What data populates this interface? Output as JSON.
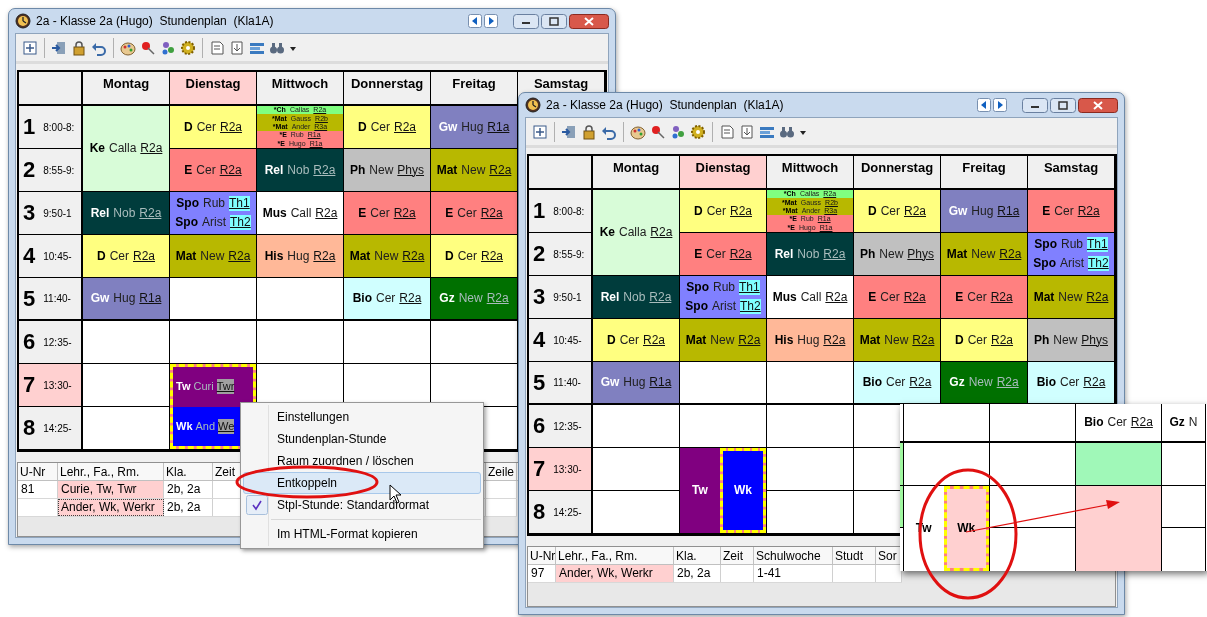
{
  "windows": [
    {
      "title": "2a - Klasse 2a (Hugo)  Stundenplan  (Kla1A)",
      "days": [
        {
          "label": "Montag",
          "highlighted": false,
          "slots": [
            {
              "kind": "lesson",
              "blocks": [
                {
                  "kind": "single",
                  "color": "#d8fcd8",
                  "selected": false,
                  "lines": [
                    {
                      "subject": "Ke",
                      "teacher": "Calla",
                      "room": "R2a",
                      "room_highlighted": false
                    }
                  ]
                }
              ]
            },
            {
              "kind": "continued"
            },
            {
              "kind": "lesson",
              "blocks": [
                {
                  "kind": "single",
                  "color": "#003c3c",
                  "selected": false,
                  "lines": [
                    {
                      "subject": "Rel",
                      "teacher": "Nob",
                      "room": "R2a",
                      "room_highlighted": false
                    }
                  ]
                }
              ]
            },
            {
              "kind": "lesson",
              "blocks": [
                {
                  "kind": "single",
                  "color": "#ffff80",
                  "selected": false,
                  "lines": [
                    {
                      "subject": "D",
                      "teacher": "Cer",
                      "room": "R2a",
                      "room_highlighted": false
                    }
                  ]
                }
              ]
            },
            {
              "kind": "lesson",
              "blocks": [
                {
                  "kind": "single",
                  "color": "#8080c0",
                  "selected": false,
                  "lines": [
                    {
                      "subject": "Gw",
                      "teacher": "Hug",
                      "room": "R1a",
                      "room_highlighted": false
                    }
                  ]
                }
              ]
            },
            {
              "kind": "empty"
            },
            {
              "kind": "empty"
            },
            {
              "kind": "empty"
            }
          ]
        },
        {
          "label": "Dienstag",
          "highlighted": true,
          "slots": [
            {
              "kind": "lesson",
              "blocks": [
                {
                  "kind": "single",
                  "color": "#ffff80",
                  "selected": false,
                  "lines": [
                    {
                      "subject": "D",
                      "teacher": "Cer",
                      "room": "R2a",
                      "room_highlighted": false
                    }
                  ]
                }
              ]
            },
            {
              "kind": "lesson",
              "blocks": [
                {
                  "kind": "single",
                  "color": "#ff8080",
                  "selected": false,
                  "lines": [
                    {
                      "subject": "E",
                      "teacher": "Cer",
                      "room": "R2a",
                      "room_highlighted": false
                    }
                  ]
                }
              ]
            },
            {
              "kind": "lesson",
              "blocks": [
                {
                  "kind": "single",
                  "color": "#8080ff",
                  "selected": false,
                  "lines": [
                    {
                      "subject": "Spo",
                      "teacher": "Rub",
                      "room": "Th1",
                      "room_highlighted": true
                    },
                    {
                      "subject": "Spo",
                      "teacher": "Arist",
                      "room": "Th2",
                      "room_highlighted": true
                    }
                  ]
                }
              ]
            },
            {
              "kind": "lesson",
              "blocks": [
                {
                  "kind": "single",
                  "color": "#b8b800",
                  "selected": false,
                  "lines": [
                    {
                      "subject": "Mat",
                      "teacher": "New",
                      "room": "R2a",
                      "room_highlighted": false
                    }
                  ]
                }
              ]
            },
            {
              "kind": "empty"
            },
            {
              "kind": "empty"
            },
            {
              "kind": "lesson",
              "blocks": [
                {
                  "kind": "split",
                  "color": "#ff8080",
                  "selected": true,
                  "lines": [
                    {
                      "subject": "Tw",
                      "teacher": "Curi",
                      "room": "Twr",
                      "room_highlighted": true,
                      "color": "#800080"
                    },
                    {
                      "subject": "Wk",
                      "teacher": "And",
                      "room": "We",
                      "room_highlighted": true,
                      "color": "#0000ff"
                    }
                  ]
                }
              ]
            },
            {
              "kind": "continued"
            }
          ]
        },
        {
          "label": "Mittwoch",
          "highlighted": false,
          "slots": [
            {
              "kind": "lesson",
              "blocks": [
                {
                  "kind": "compact",
                  "selected": false,
                  "lines": [
                    {
                      "subject": "*Ch",
                      "teacher": "Callas",
                      "room": "R2a",
                      "room_highlighted": false,
                      "color": "#80ff80"
                    },
                    {
                      "subject": "*Mat",
                      "teacher": "Gauss",
                      "room": "R2b",
                      "room_highlighted": false,
                      "color": "#b8b800"
                    },
                    {
                      "subject": "*Mat",
                      "teacher": "Ander",
                      "room": "R3a",
                      "room_highlighted": false,
                      "color": "#b8b800"
                    },
                    {
                      "subject": "*E",
                      "teacher": "Rub",
                      "room": "R1a",
                      "room_highlighted": false,
                      "color": "#ff8080"
                    },
                    {
                      "subject": "*E",
                      "teacher": "Hugo",
                      "room": "R1a",
                      "room_highlighted": false,
                      "color": "#ff8080"
                    }
                  ]
                }
              ]
            },
            {
              "kind": "lesson",
              "blocks": [
                {
                  "kind": "single",
                  "color": "#003c3c",
                  "selected": false,
                  "lines": [
                    {
                      "subject": "Rel",
                      "teacher": "Nob",
                      "room": "R2a",
                      "room_highlighted": false
                    }
                  ]
                }
              ]
            },
            {
              "kind": "lesson",
              "blocks": [
                {
                  "kind": "single",
                  "color": "#ffffff",
                  "selected": false,
                  "lines": [
                    {
                      "subject": "Mus",
                      "teacher": "Call",
                      "room": "R2a",
                      "room_highlighted": false
                    }
                  ]
                }
              ]
            },
            {
              "kind": "lesson",
              "blocks": [
                {
                  "kind": "single",
                  "color": "#ffb898",
                  "selected": false,
                  "lines": [
                    {
                      "subject": "His",
                      "teacher": "Hug",
                      "room": "R2a",
                      "room_highlighted": false
                    }
                  ]
                }
              ]
            },
            {
              "kind": "empty"
            },
            {
              "kind": "empty"
            },
            {
              "kind": "empty"
            },
            {
              "kind": "empty"
            }
          ]
        },
        {
          "label": "Donnerstag",
          "highlighted": false,
          "slots": [
            {
              "kind": "lesson",
              "blocks": [
                {
                  "kind": "single",
                  "color": "#ffff80",
                  "selected": false,
                  "lines": [
                    {
                      "subject": "D",
                      "teacher": "Cer",
                      "room": "R2a",
                      "room_highlighted": false
                    }
                  ]
                }
              ]
            },
            {
              "kind": "lesson",
              "blocks": [
                {
                  "kind": "single",
                  "color": "#c0c0c0",
                  "selected": false,
                  "lines": [
                    {
                      "subject": "Ph",
                      "teacher": "New",
                      "room": "Phys",
                      "room_highlighted": false
                    }
                  ]
                }
              ]
            },
            {
              "kind": "lesson",
              "blocks": [
                {
                  "kind": "single",
                  "color": "#ff8080",
                  "selected": false,
                  "lines": [
                    {
                      "subject": "E",
                      "teacher": "Cer",
                      "room": "R2a",
                      "room_highlighted": false
                    }
                  ]
                }
              ]
            },
            {
              "kind": "lesson",
              "blocks": [
                {
                  "kind": "single",
                  "color": "#b8b800",
                  "selected": false,
                  "lines": [
                    {
                      "subject": "Mat",
                      "teacher": "New",
                      "room": "R2a",
                      "room_highlighted": false
                    }
                  ]
                }
              ]
            },
            {
              "kind": "lesson",
              "blocks": [
                {
                  "kind": "single",
                  "color": "#d0ffff",
                  "selected": false,
                  "lines": [
                    {
                      "subject": "Bio",
                      "teacher": "Cer",
                      "room": "R2a",
                      "room_highlighted": false
                    }
                  ]
                }
              ]
            },
            {
              "kind": "empty"
            },
            {
              "kind": "empty"
            },
            {
              "kind": "empty"
            }
          ]
        },
        {
          "label": "Freitag",
          "highlighted": false,
          "slots": [
            {
              "kind": "lesson",
              "blocks": [
                {
                  "kind": "single",
                  "color": "#8080c0",
                  "selected": false,
                  "lines": [
                    {
                      "subject": "Gw",
                      "teacher": "Hug",
                      "room": "R1a",
                      "room_highlighted": false
                    }
                  ]
                }
              ]
            },
            {
              "kind": "lesson",
              "blocks": [
                {
                  "kind": "single",
                  "color": "#b8b800",
                  "selected": false,
                  "lines": [
                    {
                      "subject": "Mat",
                      "teacher": "New",
                      "room": "R2a",
                      "room_highlighted": false
                    }
                  ]
                }
              ]
            },
            {
              "kind": "lesson",
              "blocks": [
                {
                  "kind": "single",
                  "color": "#ff8080",
                  "selected": false,
                  "lines": [
                    {
                      "subject": "E",
                      "teacher": "Cer",
                      "room": "R2a",
                      "room_highlighted": false
                    }
                  ]
                }
              ]
            },
            {
              "kind": "lesson",
              "blocks": [
                {
                  "kind": "single",
                  "color": "#ffff80",
                  "selected": false,
                  "lines": [
                    {
                      "subject": "D",
                      "teacher": "Cer",
                      "room": "R2a",
                      "room_highlighted": false
                    }
                  ]
                }
              ]
            },
            {
              "kind": "lesson",
              "blocks": [
                {
                  "kind": "single",
                  "color": "#007000",
                  "selected": false,
                  "lines": [
                    {
                      "subject": "Gz",
                      "teacher": "New",
                      "room": "R2a",
                      "room_highlighted": false
                    }
                  ]
                }
              ]
            },
            {
              "kind": "empty"
            },
            {
              "kind": "empty"
            },
            {
              "kind": "empty"
            }
          ]
        },
        {
          "label": "Samstag",
          "highlighted": false
        }
      ],
      "periods": [
        {
          "number": "1",
          "time": "8:00-8:",
          "highlighted": false
        },
        {
          "number": "2",
          "time": "8:55-9:",
          "highlighted": false
        },
        {
          "number": "3",
          "time": "9:50-1",
          "highlighted": false
        },
        {
          "number": "4",
          "time": "10:45-",
          "highlighted": false
        },
        {
          "number": "5",
          "time": "11:40-",
          "highlighted": false
        },
        {
          "number": "6",
          "time": "12:35-",
          "highlighted": false
        },
        {
          "number": "7",
          "time": "13:30-",
          "highlighted": true
        },
        {
          "number": "8",
          "time": "14:25-",
          "highlighted": false
        }
      ],
      "details": {
        "columns": [
          "U-Nr",
          "Lehr., Fa., Rm.",
          "Kla.",
          "Zeit",
          "Zeile"
        ],
        "rows": [
          {
            "selected": false,
            "cells": [
              "81",
              "Curie, Tw, Twr",
              "2b, 2a",
              null,
              null
            ]
          },
          {
            "selected": true,
            "cells": [
              null,
              "Ander, Wk, Werkr",
              "2b, 2a",
              null,
              null
            ]
          }
        ]
      }
    },
    {
      "title": "2a - Klasse 2a (Hugo)  Stundenplan  (Kla1A)",
      "days": [
        {
          "label": "Montag",
          "highlighted": false,
          "slots": [
            {
              "kind": "lesson",
              "blocks": [
                {
                  "kind": "single",
                  "color": "#d8fcd8",
                  "selected": false,
                  "lines": [
                    {
                      "subject": "Ke",
                      "teacher": "Calla",
                      "room": "R2a",
                      "room_highlighted": false
                    }
                  ]
                }
              ]
            },
            {
              "kind": "continued"
            },
            {
              "kind": "lesson",
              "blocks": [
                {
                  "kind": "single",
                  "color": "#003c3c",
                  "selected": false,
                  "lines": [
                    {
                      "subject": "Rel",
                      "teacher": "Nob",
                      "room": "R2a",
                      "room_highlighted": false
                    }
                  ]
                }
              ]
            },
            {
              "kind": "lesson",
              "blocks": [
                {
                  "kind": "single",
                  "color": "#ffff80",
                  "selected": false,
                  "lines": [
                    {
                      "subject": "D",
                      "teacher": "Cer",
                      "room": "R2a",
                      "room_highlighted": false
                    }
                  ]
                }
              ]
            },
            {
              "kind": "lesson",
              "blocks": [
                {
                  "kind": "single",
                  "color": "#8080c0",
                  "selected": false,
                  "lines": [
                    {
                      "subject": "Gw",
                      "teacher": "Hug",
                      "room": "R1a",
                      "room_highlighted": false
                    }
                  ]
                }
              ]
            },
            {
              "kind": "empty"
            },
            {
              "kind": "empty"
            },
            {
              "kind": "empty"
            }
          ]
        },
        {
          "label": "Dienstag",
          "highlighted": true,
          "slots": [
            {
              "kind": "lesson",
              "blocks": [
                {
                  "kind": "single",
                  "color": "#ffff80",
                  "selected": false,
                  "lines": [
                    {
                      "subject": "D",
                      "teacher": "Cer",
                      "room": "R2a",
                      "room_highlighted": false
                    }
                  ]
                }
              ]
            },
            {
              "kind": "lesson",
              "blocks": [
                {
                  "kind": "single",
                  "color": "#ff8080",
                  "selected": false,
                  "lines": [
                    {
                      "subject": "E",
                      "teacher": "Cer",
                      "room": "R2a",
                      "room_highlighted": false
                    }
                  ]
                }
              ]
            },
            {
              "kind": "lesson",
              "blocks": [
                {
                  "kind": "single",
                  "color": "#8080ff",
                  "selected": false,
                  "lines": [
                    {
                      "subject": "Spo",
                      "teacher": "Rub",
                      "room": "Th1",
                      "room_highlighted": true
                    },
                    {
                      "subject": "Spo",
                      "teacher": "Arist",
                      "room": "Th2",
                      "room_highlighted": true
                    }
                  ]
                }
              ]
            },
            {
              "kind": "lesson",
              "blocks": [
                {
                  "kind": "single",
                  "color": "#b8b800",
                  "selected": false,
                  "lines": [
                    {
                      "subject": "Mat",
                      "teacher": "New",
                      "room": "R2a",
                      "room_highlighted": false
                    }
                  ]
                }
              ]
            },
            {
              "kind": "empty"
            },
            {
              "kind": "empty"
            },
            {
              "kind": "lesson",
              "blocks": [
                {
                  "kind": "single",
                  "color": "#800080",
                  "selected": false,
                  "lines": [
                    {
                      "subject": "Tw"
                    }
                  ]
                },
                {
                  "kind": "single",
                  "color": "#0000ff",
                  "selected": true,
                  "lines": [
                    {
                      "subject": "Wk"
                    }
                  ]
                }
              ]
            },
            {
              "kind": "continued"
            }
          ]
        },
        {
          "label": "Mittwoch",
          "highlighted": false,
          "slots": [
            {
              "kind": "lesson",
              "blocks": [
                {
                  "kind": "compact",
                  "selected": false,
                  "lines": [
                    {
                      "subject": "*Ch",
                      "teacher": "Callas",
                      "room": "R2a",
                      "room_highlighted": false,
                      "color": "#80ff80"
                    },
                    {
                      "subject": "*Mat",
                      "teacher": "Gauss",
                      "room": "R2b",
                      "room_highlighted": false,
                      "color": "#b8b800"
                    },
                    {
                      "subject": "*Mat",
                      "teacher": "Ander",
                      "room": "R3a",
                      "room_highlighted": false,
                      "color": "#b8b800"
                    },
                    {
                      "subject": "*E",
                      "teacher": "Rub",
                      "room": "R1a",
                      "room_highlighted": false,
                      "color": "#ff8080"
                    },
                    {
                      "subject": "*E",
                      "teacher": "Hugo",
                      "room": "R1a",
                      "room_highlighted": false,
                      "color": "#ff8080"
                    }
                  ]
                }
              ]
            },
            {
              "kind": "lesson",
              "blocks": [
                {
                  "kind": "single",
                  "color": "#003c3c",
                  "selected": false,
                  "lines": [
                    {
                      "subject": "Rel",
                      "teacher": "Nob",
                      "room": "R2a",
                      "room_highlighted": false
                    }
                  ]
                }
              ]
            },
            {
              "kind": "lesson",
              "blocks": [
                {
                  "kind": "single",
                  "color": "#ffffff",
                  "selected": false,
                  "lines": [
                    {
                      "subject": "Mus",
                      "teacher": "Call",
                      "room": "R2a",
                      "room_highlighted": false
                    }
                  ]
                }
              ]
            },
            {
              "kind": "lesson",
              "blocks": [
                {
                  "kind": "single",
                  "color": "#ffb898",
                  "selected": false,
                  "lines": [
                    {
                      "subject": "His",
                      "teacher": "Hug",
                      "room": "R2a",
                      "room_highlighted": false
                    }
                  ]
                }
              ]
            },
            {
              "kind": "empty"
            },
            {
              "kind": "empty"
            },
            {
              "kind": "empty"
            },
            {
              "kind": "empty"
            }
          ]
        },
        {
          "label": "Donnerstag",
          "highlighted": false,
          "slots": [
            {
              "kind": "lesson",
              "blocks": [
                {
                  "kind": "single",
                  "color": "#ffff80",
                  "selected": false,
                  "lines": [
                    {
                      "subject": "D",
                      "teacher": "Cer",
                      "room": "R2a",
                      "room_highlighted": false
                    }
                  ]
                }
              ]
            },
            {
              "kind": "lesson",
              "blocks": [
                {
                  "kind": "single",
                  "color": "#c0c0c0",
                  "selected": false,
                  "lines": [
                    {
                      "subject": "Ph",
                      "teacher": "New",
                      "room": "Phys",
                      "room_highlighted": false
                    }
                  ]
                }
              ]
            },
            {
              "kind": "lesson",
              "blocks": [
                {
                  "kind": "single",
                  "color": "#ff8080",
                  "selected": false,
                  "lines": [
                    {
                      "subject": "E",
                      "teacher": "Cer",
                      "room": "R2a",
                      "room_highlighted": false
                    }
                  ]
                }
              ]
            },
            {
              "kind": "lesson",
              "blocks": [
                {
                  "kind": "single",
                  "color": "#b8b800",
                  "selected": false,
                  "lines": [
                    {
                      "subject": "Mat",
                      "teacher": "New",
                      "room": "R2a",
                      "room_highlighted": false
                    }
                  ]
                }
              ]
            },
            {
              "kind": "lesson",
              "blocks": [
                {
                  "kind": "single",
                  "color": "#d0ffff",
                  "selected": false,
                  "lines": [
                    {
                      "subject": "Bio",
                      "teacher": "Cer",
                      "room": "R2a",
                      "room_highlighted": false
                    }
                  ]
                }
              ]
            },
            {
              "kind": "empty"
            },
            {
              "kind": "empty"
            },
            {
              "kind": "empty"
            }
          ]
        },
        {
          "label": "Freitag",
          "highlighted": false,
          "slots": [
            {
              "kind": "lesson",
              "blocks": [
                {
                  "kind": "single",
                  "color": "#8080c0",
                  "selected": false,
                  "lines": [
                    {
                      "subject": "Gw",
                      "teacher": "Hug",
                      "room": "R1a",
                      "room_highlighted": false
                    }
                  ]
                }
              ]
            },
            {
              "kind": "lesson",
              "blocks": [
                {
                  "kind": "single",
                  "color": "#b8b800",
                  "selected": false,
                  "lines": [
                    {
                      "subject": "Mat",
                      "teacher": "New",
                      "room": "R2a",
                      "room_highlighted": false
                    }
                  ]
                }
              ]
            },
            {
              "kind": "lesson",
              "blocks": [
                {
                  "kind": "single",
                  "color": "#ff8080",
                  "selected": false,
                  "lines": [
                    {
                      "subject": "E",
                      "teacher": "Cer",
                      "room": "R2a",
                      "room_highlighted": false
                    }
                  ]
                }
              ]
            },
            {
              "kind": "lesson",
              "blocks": [
                {
                  "kind": "single",
                  "color": "#ffff80",
                  "selected": false,
                  "lines": [
                    {
                      "subject": "D",
                      "teacher": "Cer",
                      "room": "R2a",
                      "room_highlighted": false
                    }
                  ]
                }
              ]
            },
            {
              "kind": "lesson",
              "blocks": [
                {
                  "kind": "single",
                  "color": "#007000",
                  "selected": false,
                  "lines": [
                    {
                      "subject": "Gz",
                      "teacher": "New",
                      "room": "R2a",
                      "room_highlighted": false
                    }
                  ]
                }
              ]
            }
          ]
        },
        {
          "label": "Samstag",
          "highlighted": false,
          "slots": [
            {
              "kind": "lesson",
              "blocks": [
                {
                  "kind": "single",
                  "color": "#ff8080",
                  "selected": false,
                  "lines": [
                    {
                      "subject": "E",
                      "teacher": "Cer",
                      "room": "R2a",
                      "room_highlighted": false
                    }
                  ]
                }
              ]
            },
            {
              "kind": "lesson",
              "blocks": [
                {
                  "kind": "single",
                  "color": "#8080ff",
                  "selected": false,
                  "lines": [
                    {
                      "subject": "Spo",
                      "teacher": "Rub",
                      "room": "Th1",
                      "room_highlighted": true
                    },
                    {
                      "subject": "Spo",
                      "teacher": "Arist",
                      "room": "Th2",
                      "room_highlighted": true
                    }
                  ]
                }
              ]
            },
            {
              "kind": "lesson",
              "blocks": [
                {
                  "kind": "single",
                  "color": "#b8b800",
                  "selected": false,
                  "lines": [
                    {
                      "subject": "Mat",
                      "teacher": "New",
                      "room": "R2a",
                      "room_highlighted": false
                    }
                  ]
                }
              ]
            },
            {
              "kind": "lesson",
              "blocks": [
                {
                  "kind": "single",
                  "color": "#c0c0c0",
                  "selected": false,
                  "lines": [
                    {
                      "subject": "Ph",
                      "teacher": "New",
                      "room": "Phys",
                      "room_highlighted": false
                    }
                  ]
                }
              ]
            },
            {
              "kind": "lesson",
              "blocks": [
                {
                  "kind": "single",
                  "color": "#d0ffff",
                  "selected": false,
                  "lines": [
                    {
                      "subject": "Bio",
                      "teacher": "Cer",
                      "room": "R2a",
                      "room_highlighted": false
                    }
                  ]
                }
              ]
            }
          ]
        }
      ],
      "periods": [
        {
          "number": "1",
          "time": "8:00-8:",
          "highlighted": false
        },
        {
          "number": "2",
          "time": "8:55-9:",
          "highlighted": false
        },
        {
          "number": "3",
          "time": "9:50-1",
          "highlighted": false
        },
        {
          "number": "4",
          "time": "10:45-",
          "highlighted": false
        },
        {
          "number": "5",
          "time": "11:40-",
          "highlighted": false
        },
        {
          "number": "6",
          "time": "12:35-",
          "highlighted": false
        },
        {
          "number": "7",
          "time": "13:30-",
          "highlighted": true
        },
        {
          "number": "8",
          "time": "14:25-",
          "highlighted": false
        }
      ],
      "details": {
        "columns": [
          "U-Nr",
          "Lehr., Fa., Rm.",
          "Kla.",
          "Zeit",
          "Schulwoche",
          "Studt",
          "Sor"
        ],
        "rows": [
          {
            "selected": false,
            "cells": [
              "97",
              "Ander, Wk, Werkr",
              "2b, 2a",
              null,
              "1-41",
              null,
              null
            ]
          }
        ]
      }
    }
  ],
  "context_menu": {
    "items": [
      {
        "kind": "item",
        "label": "Einstellungen",
        "selected": false,
        "checked": false
      },
      {
        "kind": "item",
        "label": "Stundenplan-Stunde",
        "selected": false,
        "checked": false
      },
      {
        "kind": "item",
        "label": "Raum zuordnen / löschen",
        "selected": false,
        "checked": false
      },
      {
        "kind": "item",
        "label": "Entkoppeln",
        "selected": true,
        "checked": false
      },
      {
        "kind": "item",
        "label": "Stpl-Stunde: Standardformat",
        "selected": false,
        "checked": true
      },
      {
        "kind": "separator"
      },
      {
        "kind": "item",
        "label": "Im HTML-Format kopieren",
        "selected": false,
        "checked": false
      }
    ]
  },
  "zoom_inset": {
    "columns": [
      {
        "slots": [
          {
            "kind": "empty"
          },
          {
            "kind": "lesson",
            "blocks": [
              {
                "kind": "single",
                "color": "#a0f8a0",
                "selected": false
              }
            ]
          },
          {
            "kind": "lesson",
            "blocks": [
              {
                "kind": "single",
                "color": "#a0f8a0",
                "selected": false
              }
            ]
          },
          {
            "kind": "empty"
          }
        ]
      },
      {
        "slots": [
          {
            "kind": "empty"
          },
          {
            "kind": "empty"
          },
          {
            "kind": "lesson",
            "blocks": [
              {
                "kind": "single",
                "color": "#ffffff",
                "selected": false,
                "lines": [
                  {
                    "subject": "Tw"
                  }
                ]
              },
              {
                "kind": "single",
                "color": "#ffd0d0",
                "selected": true,
                "lines": [
                  {
                    "subject": "Wk"
                  }
                ]
              }
            ]
          },
          {
            "kind": "continued"
          }
        ]
      },
      {
        "slots": [
          {
            "kind": "empty"
          },
          {
            "kind": "empty"
          },
          {
            "kind": "empty"
          },
          {
            "kind": "empty"
          }
        ]
      },
      {
        "slots": [
          {
            "kind": "lesson",
            "blocks": [
              {
                "kind": "single",
                "color": "#ffffff",
                "selected": false,
                "lines": [
                  {
                    "subject": "Bio",
                    "teacher": "Cer",
                    "room": "R2a",
                    "room_highlighted": false
                  }
                ]
              }
            ]
          },
          {
            "kind": "lesson",
            "blocks": [
              {
                "kind": "single",
                "color": "#a0f8b8",
                "selected": false
              }
            ]
          },
          {
            "kind": "lesson",
            "blocks": [
              {
                "kind": "single",
                "color": "#ffd0d0",
                "selected": false
              }
            ]
          },
          {
            "kind": "continued"
          }
        ]
      },
      {
        "slots": [
          {
            "kind": "lesson",
            "blocks": [
              {
                "kind": "single",
                "color": "#ffffff",
                "selected": false,
                "lines": [
                  {
                    "subject": "Gz",
                    "teacher": "N"
                  }
                ]
              }
            ]
          },
          {
            "kind": "empty"
          },
          {
            "kind": "empty"
          },
          {
            "kind": "empty"
          }
        ]
      }
    ]
  }
}
